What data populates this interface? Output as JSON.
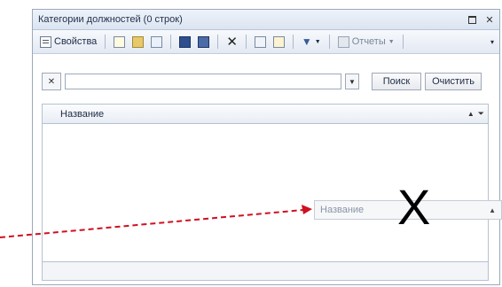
{
  "window": {
    "title": "Категории должностей (0 строк)"
  },
  "toolbar": {
    "properties_label": "Свойства",
    "reports_label": "Отчеты"
  },
  "search": {
    "value": "",
    "placeholder": "",
    "search_button": "Поиск",
    "clear_button": "Очистить"
  },
  "grid": {
    "column_name": "Название",
    "sort_glyph": "▲"
  },
  "drag": {
    "column_label": "Название",
    "forbidden_mark": "X"
  },
  "colors": {
    "arrow": "#d01020",
    "title_bg": "#dbe4f1",
    "border": "#9aa9bd"
  }
}
